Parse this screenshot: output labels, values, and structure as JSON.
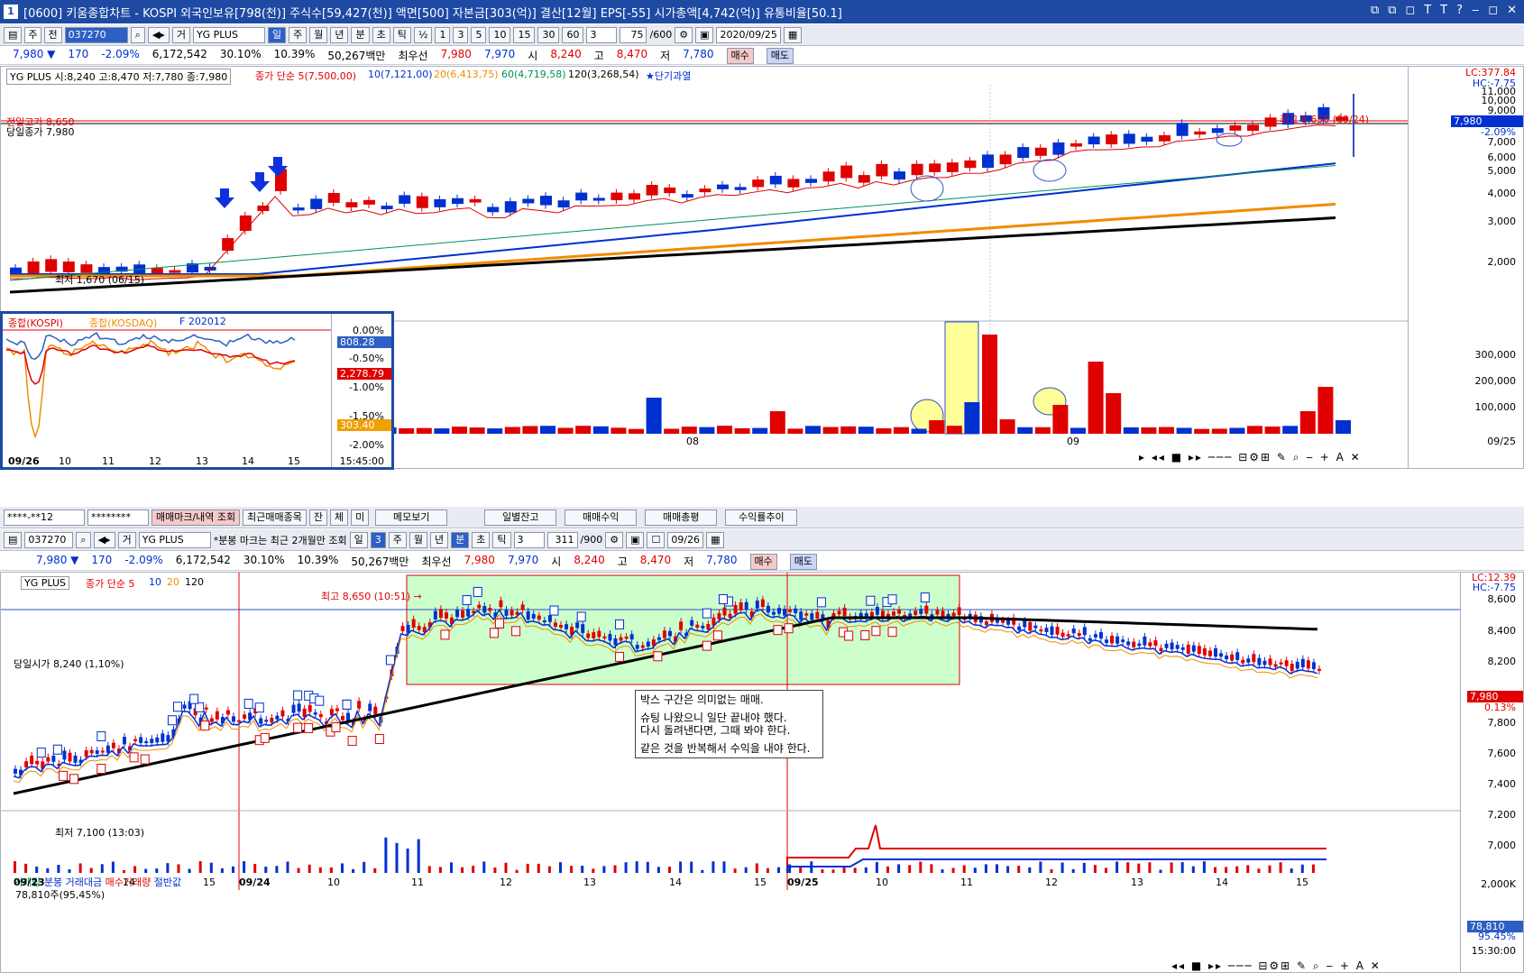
{
  "window": {
    "logo": "1",
    "title": "[0600] 키움종합차트 - KOSPI 외국인보유[798(천)] 주식수[59,427(천)] 액면[500] 자본금[303(억)] 결산[12월] EPS[-55] 시가총액[4,742(억)] 유통비율[50.1]",
    "controls": [
      "⧉",
      "⧉",
      "◻",
      "T",
      "T",
      "?",
      "‒",
      "◻",
      "✕"
    ]
  },
  "toolbar1": {
    "period": "주",
    "type": "전",
    "code": "037270",
    "market": "거",
    "name": "YG PLUS",
    "periods": [
      "일",
      "주",
      "월",
      "년",
      "분",
      "초",
      "틱"
    ],
    "selected_period": "일",
    "ratio": "½",
    "nums": [
      "1",
      "3",
      "5",
      "10",
      "15",
      "30",
      "60"
    ],
    "num": "3",
    "count": "75",
    "max": "/600",
    "date": "2020/09/25"
  },
  "quote1": {
    "price": "7,980 ▼",
    "change": "170",
    "pct": "-2.09%",
    "volume": "6,172,542",
    "r1": "30.10%",
    "r2": "10.39%",
    "amount": "50,267백만",
    "best_label": "최우선",
    "ask": "7,980",
    "bid": "7,970",
    "open_l": "시",
    "open": "8,240",
    "high_l": "고",
    "high": "8,470",
    "low_l": "저",
    "low": "7,780",
    "buy": "매수",
    "sell": "매도"
  },
  "top_chart": {
    "legend_name": "YG PLUS 시:8,240 고:8,470 저:7,780 종:7,980",
    "legend_ma": "종가 단순 5(7,500,00)",
    "ma10": "10(7,121,00)",
    "ma20": "20(6,413,75)",
    "ma60": "60(4,719,58)",
    "ma120": "120(3,268,54)",
    "legend_alert": "★단기과열",
    "prev_high": "전일고가 8,650",
    "close_label": "당일종가 7,980",
    "max_label": "최고 8,650 (09/24)",
    "min_label": "최저 1,670 (06/15)",
    "lc": "LC:377.84",
    "hc": "HC:-7.75",
    "y_ticks": [
      "11,000",
      "10,000",
      "9,000",
      "8,000",
      "7,000",
      "6,000",
      "5,000",
      "4,000",
      "3,000",
      "2,000"
    ],
    "price_tag": "7,980",
    "pct_tag": "-2.09%",
    "vol_ticks": [
      "300,000",
      "200,000",
      "100,000"
    ],
    "x_ticks": [
      "08",
      "09",
      "09/25"
    ]
  },
  "index_panel": {
    "l1": "종합(KOSPI)",
    "l2": "종합(KOSDAQ)",
    "l3": "F 202012",
    "ticks": [
      "0.00%",
      "-0.50%",
      "-1.00%",
      "-1.50%",
      "-2.00%"
    ],
    "v1": "303.40",
    "v2": "2,278.79",
    "v3": "808.28",
    "x": [
      "09/26",
      "10",
      "11",
      "12",
      "13",
      "14",
      "15"
    ],
    "time": "15:45:00"
  },
  "toolbar2": {
    "account": "****-**12",
    "pw": "********",
    "btn1": "매매마크/내역 조회",
    "btn2": "최근매매종목",
    "btn3": "잔",
    "btn4": "체",
    "btn5": "미",
    "memo": "메모보기",
    "daily": "일별잔고",
    "profit": "매매수익",
    "total": "매매총평",
    "trend": "수익률추이"
  },
  "toolbar3": {
    "code": "037270",
    "market": "거",
    "name": "YG PLUS",
    "note": "*분봉 마크는 최근 2개월만 조회",
    "num": "3",
    "periods": [
      "주",
      "월",
      "년",
      "분",
      "초",
      "틱"
    ],
    "tick": "3",
    "count": "311",
    "max": "/900",
    "date": "09/26"
  },
  "quote2": {
    "price": "7,980 ▼",
    "change": "170",
    "pct": "-2.09%",
    "volume": "6,172,542",
    "r1": "30.10%",
    "r2": "10.39%",
    "amount": "50,267백만",
    "best_label": "최우선",
    "ask": "7,980",
    "bid": "7,970",
    "open_l": "시",
    "open": "8,240",
    "high_l": "고",
    "high": "8,470",
    "low_l": "저",
    "low": "7,780",
    "buy": "매수",
    "sell": "매도"
  },
  "bottom_chart": {
    "legend_name": "YG PLUS",
    "legend_ma": "종가 단순 5",
    "ma10": "10",
    "ma20": "20",
    "ma120": "120",
    "max_label": "최고 8,650 (10:51) →",
    "open_label": "당일시가 8,240 (1,10%)",
    "min_label": "최저 7,100 (13:03)",
    "lc": "LC:12.39",
    "hc": "HC:-7.75",
    "y_ticks": [
      "8,600",
      "8,400",
      "8,200",
      "8,000",
      "7,800",
      "7,600",
      "7,400",
      "7,200",
      "7,000"
    ],
    "price_tag": "7,980",
    "pct_tag": "0.13%",
    "memo": [
      "박스 구간은 의미없는 매매.",
      "슈팅 나왔으니 일단 끝내야 했다.",
      "다시 돌려낸다면, 그때 봐야 한다.",
      "같은 것을 반복해서 수익을 내야 한다."
    ],
    "vol_legend": [
      "거래량",
      "분봉 거래대금",
      "매수거래량",
      "절반값"
    ],
    "vol_value": "78,810주(95,45%)",
    "vol_ticks": [
      "2,000K"
    ],
    "vol_tag": "78,810",
    "vol_pct": "95.45%",
    "x_ticks": [
      "09/23",
      "14",
      "15",
      "09/24",
      "10",
      "11",
      "12",
      "13",
      "14",
      "15",
      "09/25",
      "10",
      "11",
      "12",
      "13",
      "14",
      "15"
    ],
    "time": "15:30:00"
  },
  "colors": {
    "up": "#e00000",
    "down": "#0030d0",
    "ma20": "#f08c00",
    "ma60": "#009060",
    "ma120": "#000000",
    "title": "#1e4aa3",
    "box": "#ccffcc"
  }
}
